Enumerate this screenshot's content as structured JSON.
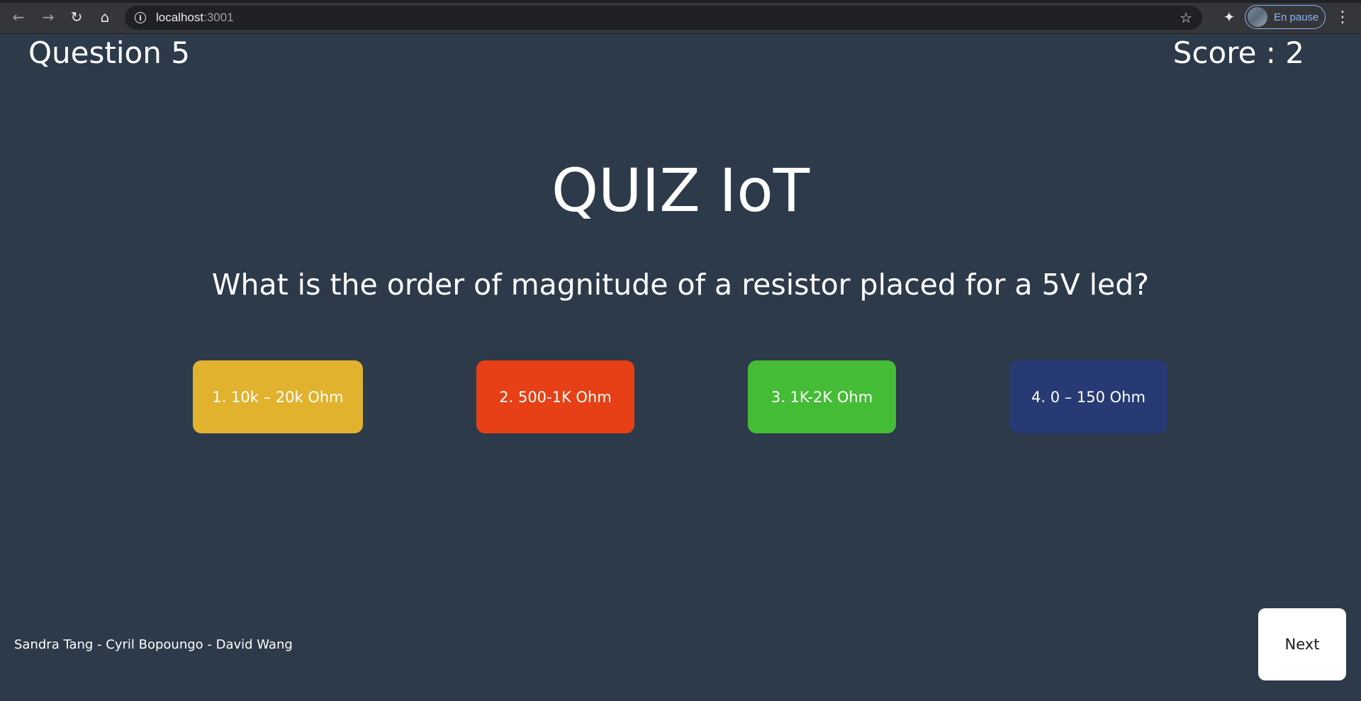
{
  "browser": {
    "url_host": "localhost",
    "url_port": ":3001",
    "profile_label": "En pause",
    "icons": {
      "back": "←",
      "forward": "→",
      "reload": "↻",
      "home": "⌂",
      "info": "i",
      "star": "☆",
      "extensions": "✦",
      "menu": "⋮"
    }
  },
  "page": {
    "question_label": "Question 5",
    "score_label": "Score : 2",
    "title": "QUIZ IoT",
    "question_text": "What is the order of magnitude of a resistor placed for a 5V led?",
    "answers": [
      {
        "label": "1. 10k – 20k Ohm",
        "color": "#e0b22d"
      },
      {
        "label": "2. 500-1K Ohm",
        "color": "#e74016"
      },
      {
        "label": "3. 1K-2K Ohm",
        "color": "#45bc36"
      },
      {
        "label": "4. 0 – 150 Ohm",
        "color": "#273a74"
      }
    ],
    "authors": "Sandra Tang - Cyril Bopoungo - David Wang",
    "next_label": "Next",
    "background_color": "#2d3a4a"
  }
}
